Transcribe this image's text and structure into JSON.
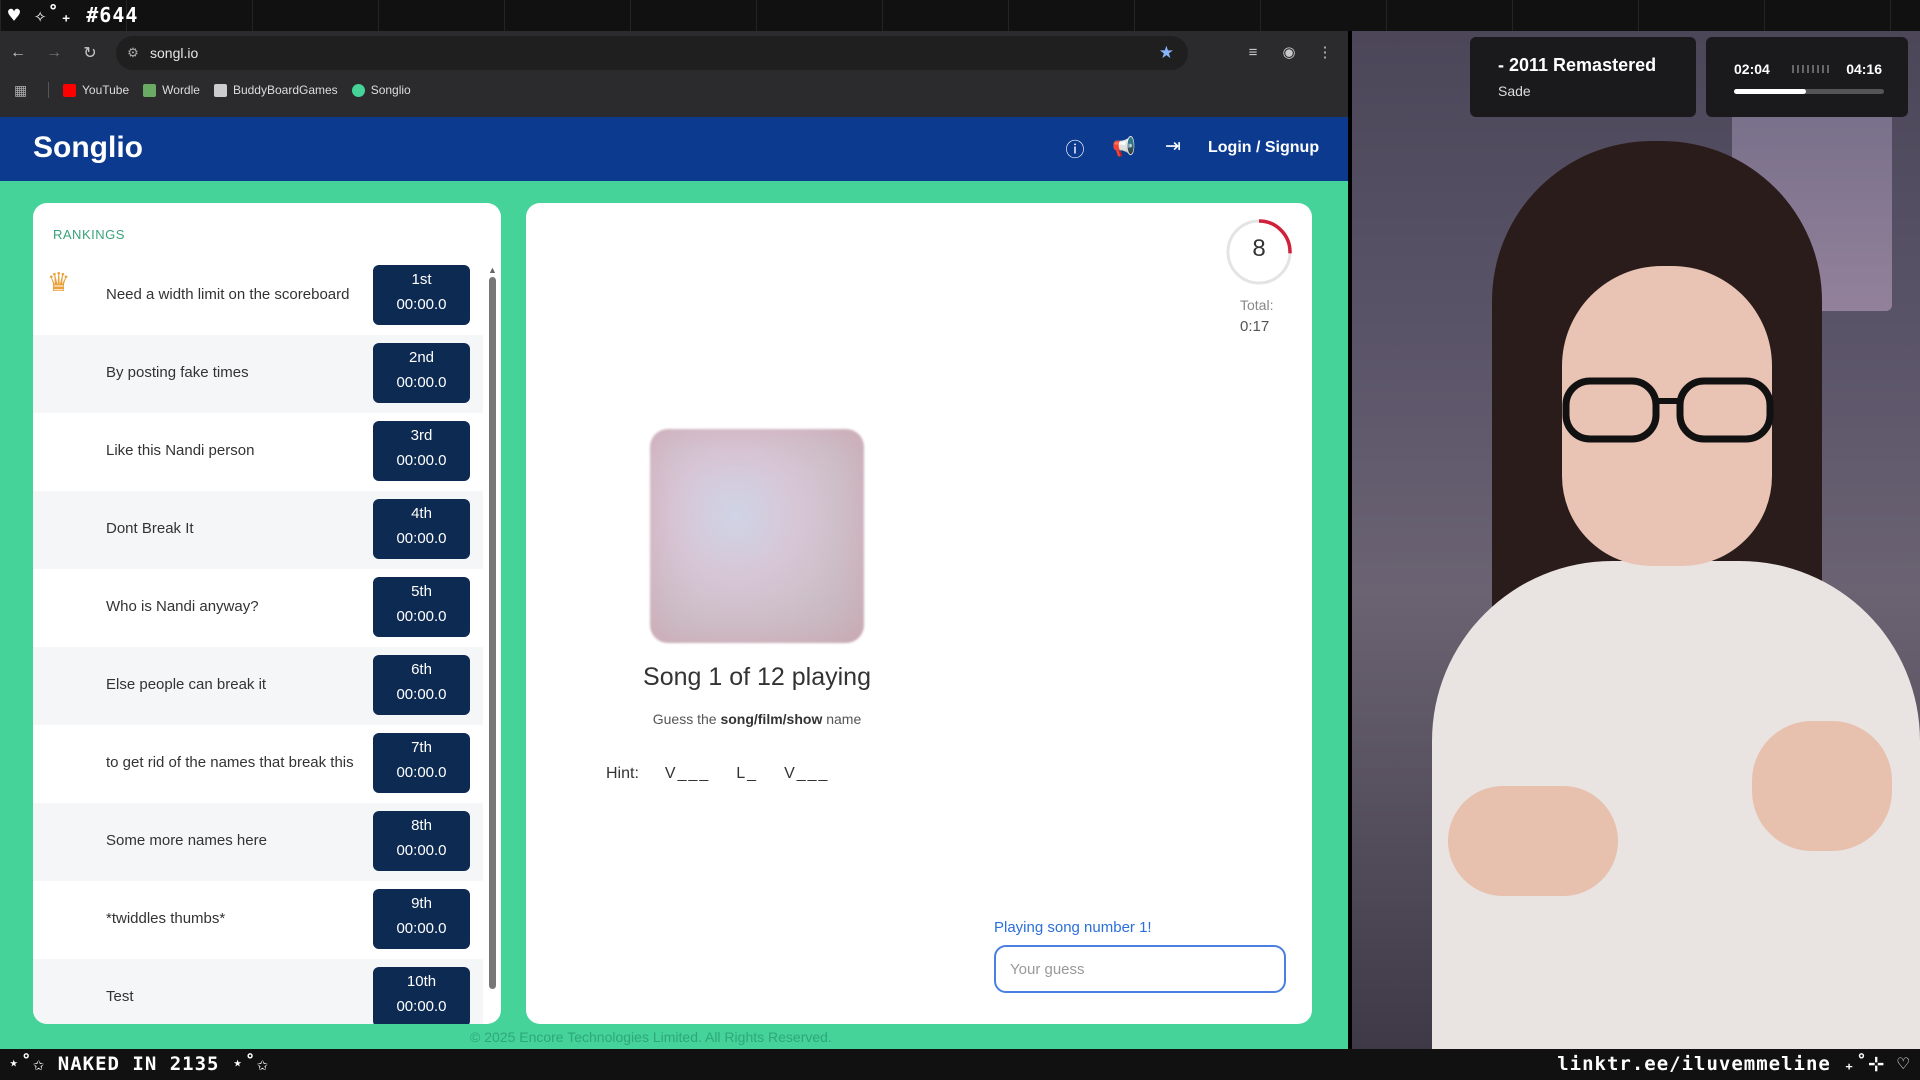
{
  "overlay": {
    "top_label": "♥ ✧˚₊ #644",
    "bottom_left": "⋆˚✩ NAKED IN 2135 ⋆˚✩",
    "bottom_right": "linktr.ee/iluvemmeline ₊˚⊹ ♡"
  },
  "browser": {
    "url": "songl.io",
    "bookmarks": [
      {
        "label": "YouTube",
        "color": "#ff0000"
      },
      {
        "label": "Wordle",
        "color": "#6aaa64"
      },
      {
        "label": "BuddyBoardGames",
        "color": "#cccccc"
      },
      {
        "label": "Songlio",
        "color": "#45d39a"
      }
    ]
  },
  "app": {
    "logo": "Songlio",
    "login_label": "Login / Signup",
    "accent_color": "#45d39a",
    "header_color": "#0b3a8e"
  },
  "rankings": {
    "title": "RANKINGS",
    "rows": [
      {
        "name": "Need a width limit on the scoreboard",
        "place": "1st",
        "time": "00:00.0"
      },
      {
        "name": "By posting fake times",
        "place": "2nd",
        "time": "00:00.0"
      },
      {
        "name": "Like this Nandi person",
        "place": "3rd",
        "time": "00:00.0"
      },
      {
        "name": "Dont Break It",
        "place": "4th",
        "time": "00:00.0"
      },
      {
        "name": "Who is Nandi anyway?",
        "place": "5th",
        "time": "00:00.0"
      },
      {
        "name": "Else people can break it",
        "place": "6th",
        "time": "00:00.0"
      },
      {
        "name": "to get rid of the names that break this",
        "place": "7th",
        "time": "00:00.0"
      },
      {
        "name": "Some more names here",
        "place": "8th",
        "time": "00:00.0"
      },
      {
        "name": "*twiddles thumbs*",
        "place": "9th",
        "time": "00:00.0"
      },
      {
        "name": "Test",
        "place": "10th",
        "time": "00:00.0"
      }
    ]
  },
  "game": {
    "timer": "8",
    "total_label": "Total:",
    "total_value": "0:17",
    "song_status": "Song 1 of 12 playing",
    "prompt_prefix": "Guess the ",
    "prompt_bold": "song/film/show",
    "prompt_suffix": " name",
    "hint_label": "Hint:",
    "hint_words": [
      "V___",
      "L_",
      "V___"
    ],
    "playing_message": "Playing song number 1!",
    "guess_placeholder": "Your guess"
  },
  "footer": "© 2025 Encore Technologies Limited. All Rights Reserved.",
  "now_playing": {
    "title": "- 2011 Remastered",
    "artist": "Sade",
    "elapsed": "02:04",
    "total": "04:16",
    "progress": 0.48
  }
}
